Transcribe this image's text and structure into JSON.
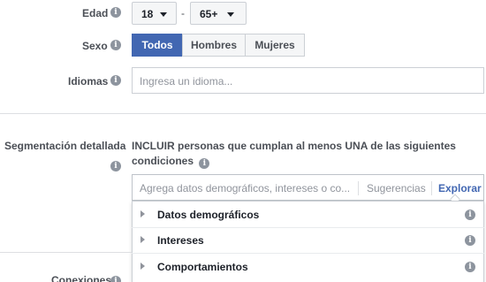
{
  "age": {
    "label": "Edad",
    "min": "18",
    "separator": "-",
    "max": "65+"
  },
  "gender": {
    "label": "Sexo",
    "options": [
      "Todos",
      "Hombres",
      "Mujeres"
    ],
    "selected": "Todos"
  },
  "languages": {
    "label": "Idiomas",
    "placeholder": "Ingresa un idioma..."
  },
  "detailed_targeting": {
    "label": "Segmentación detallada",
    "include_text": "INCLUIR personas que cumplan al menos UNA de las siguientes condiciones",
    "search_placeholder": "Agrega datos demográficos, intereses o co...",
    "suggestions_label": "Sugerencias",
    "explore_label": "Explorar",
    "categories": [
      "Datos demográficos",
      "Intereses",
      "Comportamientos"
    ]
  },
  "next_section": {
    "label": "Conexiones"
  },
  "colors": {
    "accent": "#4267b2",
    "link": "#4267b2",
    "border": "#ccd0d5",
    "icon_gray": "#8d949e"
  }
}
